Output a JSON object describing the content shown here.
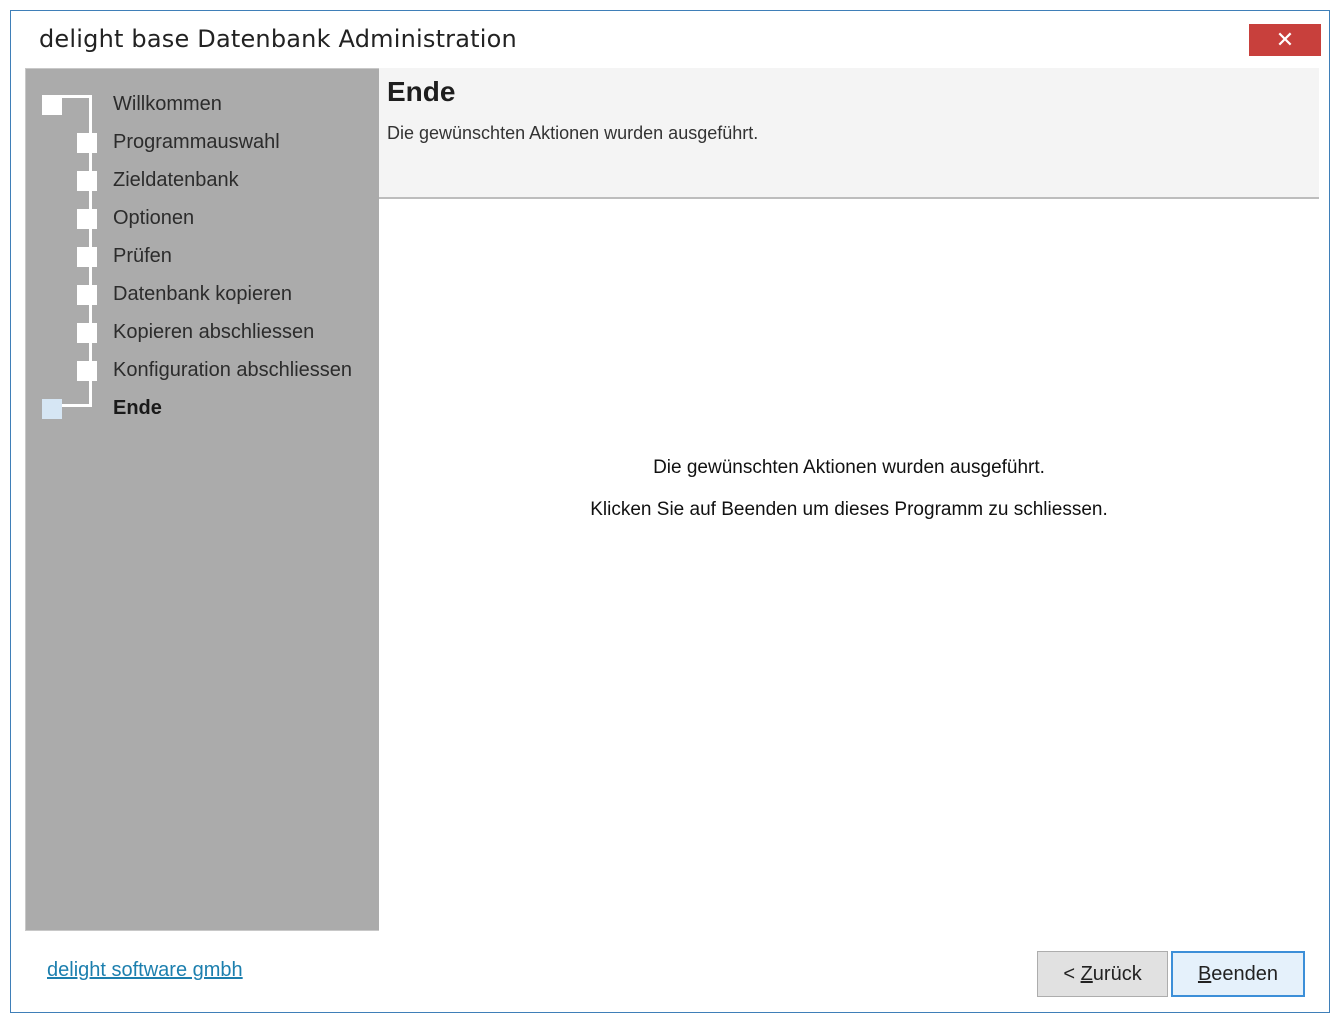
{
  "window": {
    "title": "delight base Datenbank Administration",
    "close_label": "✕"
  },
  "sidebar": {
    "steps": [
      {
        "label": "Willkommen"
      },
      {
        "label": "Programmauswahl"
      },
      {
        "label": "Zieldatenbank"
      },
      {
        "label": "Optionen"
      },
      {
        "label": "Prüfen"
      },
      {
        "label": "Datenbank kopieren"
      },
      {
        "label": "Kopieren abschliessen"
      },
      {
        "label": "Konfiguration abschliessen"
      },
      {
        "label": "Ende",
        "active": true
      }
    ]
  },
  "header": {
    "title": "Ende",
    "subtitle": "Die gewünschten Aktionen wurden ausgeführt."
  },
  "content": {
    "line1": "Die gewünschten Aktionen wurden ausgeführt.",
    "line2": "Klicken Sie auf Beenden um dieses Programm zu schliessen."
  },
  "footer": {
    "company_link": "delight software gmbh",
    "back_prefix": "< ",
    "back_mnemonic": "Z",
    "back_rest": "urück",
    "finish_mnemonic": "B",
    "finish_rest": "eenden"
  },
  "colors": {
    "sidebar_bg": "#ababab",
    "close_bg": "#c8403c",
    "link": "#1c7fae",
    "active_step_box": "#d6e6f4",
    "default_button_border": "#3c8fd8"
  }
}
